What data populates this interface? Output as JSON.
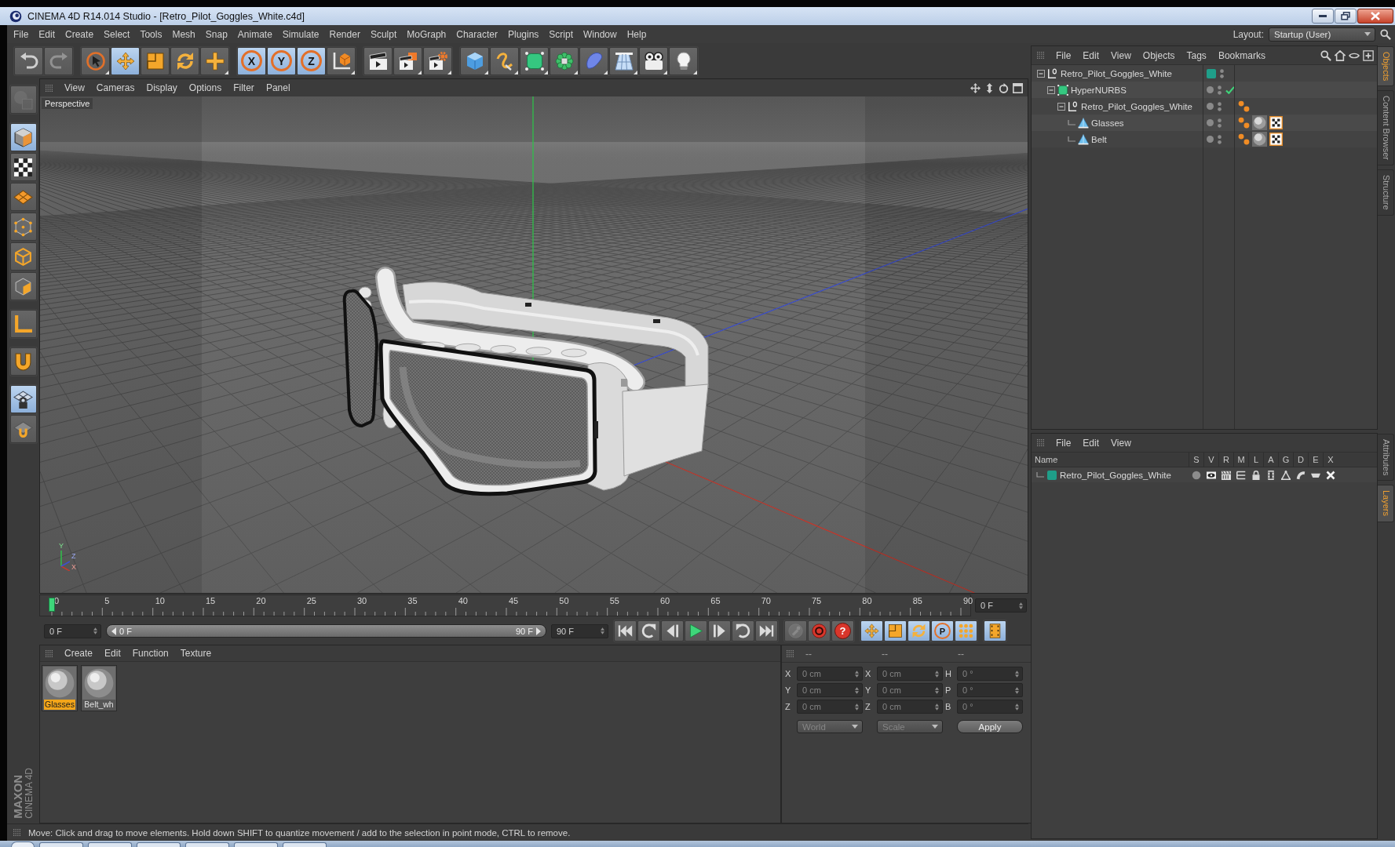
{
  "window": {
    "title": "CINEMA 4D R14.014 Studio - [Retro_Pilot_Goggles_White.c4d]"
  },
  "menu_bar": [
    "File",
    "Edit",
    "Create",
    "Select",
    "Tools",
    "Mesh",
    "Snap",
    "Animate",
    "Simulate",
    "Render",
    "Sculpt",
    "MoGraph",
    "Character",
    "Plugins",
    "Script",
    "Window",
    "Help"
  ],
  "layout": {
    "label": "Layout:",
    "value": "Startup (User)"
  },
  "toolbar": [
    {
      "tools": [
        {
          "kind": "undo",
          "disabled": false
        },
        {
          "kind": "redo",
          "disabled": true
        }
      ]
    },
    {
      "tools": [
        {
          "kind": "live-selection",
          "selected": false
        },
        {
          "kind": "move",
          "selected": true
        },
        {
          "kind": "scale",
          "selected": false
        },
        {
          "kind": "rotate",
          "selected": false
        },
        {
          "kind": "last-tool",
          "selected": false
        }
      ]
    },
    {
      "tools": [
        {
          "kind": "axis-lock",
          "label": "X",
          "selected": true
        },
        {
          "kind": "axis-lock",
          "label": "Y",
          "selected": true
        },
        {
          "kind": "axis-lock",
          "label": "Z",
          "selected": true
        },
        {
          "kind": "coordinate-system",
          "selected": false
        }
      ]
    },
    {
      "tools": [
        {
          "kind": "render-view"
        },
        {
          "kind": "render"
        },
        {
          "kind": "render-settings"
        }
      ]
    },
    {
      "tools": [
        {
          "kind": "cube"
        },
        {
          "kind": "spline"
        },
        {
          "kind": "subdivision"
        },
        {
          "kind": "cloner"
        },
        {
          "kind": "deformer"
        },
        {
          "kind": "floor"
        },
        {
          "kind": "camera"
        },
        {
          "kind": "light"
        }
      ]
    }
  ],
  "left_toolbar": [
    {
      "tools": [
        {
          "kind": "make-editable",
          "disabled": true
        }
      ]
    },
    {
      "tools": [
        {
          "kind": "model",
          "selected": true
        },
        {
          "kind": "texture",
          "selected": false
        },
        {
          "kind": "workplane",
          "selected": false
        },
        {
          "kind": "points",
          "selected": false
        },
        {
          "kind": "edges",
          "selected": false
        },
        {
          "kind": "polygons",
          "selected": false
        }
      ]
    },
    {
      "tools": [
        {
          "kind": "axis-mode",
          "selected": false
        }
      ]
    },
    {
      "tools": [
        {
          "kind": "snap",
          "selected": false
        }
      ]
    },
    {
      "tools": [
        {
          "kind": "workplane-lock",
          "selected": true
        },
        {
          "kind": "tweak",
          "selected": false
        }
      ]
    }
  ],
  "brand": {
    "lines": [
      "MAXON",
      "CINEMA 4D"
    ]
  },
  "viewport": {
    "menu": [
      "View",
      "Cameras",
      "Display",
      "Options",
      "Filter",
      "Panel"
    ],
    "camera": "Perspective",
    "gizmo": [
      {
        "kind": "y",
        "label": "Y"
      },
      {
        "kind": "z",
        "label": "Z"
      },
      {
        "kind": "x",
        "label": "X"
      }
    ]
  },
  "timeline": {
    "ticks": [
      "0",
      "5",
      "10",
      "15",
      "20",
      "25",
      "30",
      "35",
      "40",
      "45",
      "50",
      "55",
      "60",
      "65",
      "70",
      "75",
      "80",
      "85",
      "90"
    ],
    "level": 0,
    "frame": "0 F"
  },
  "transport": {
    "start": "0 F",
    "range_start": "0 F",
    "range_end": "90 F",
    "end": "90 F",
    "groups": [
      {
        "buttons": [
          {
            "kind": "first"
          },
          {
            "kind": "previous-key"
          },
          {
            "kind": "previous-frame"
          },
          {
            "kind": "play"
          },
          {
            "kind": "next-frame"
          },
          {
            "kind": "next-key"
          },
          {
            "kind": "last"
          }
        ]
      },
      {
        "buttons": [
          {
            "kind": "record-keys",
            "disabled": true
          },
          {
            "kind": "autokey",
            "disabled": false
          },
          {
            "kind": "keyframe-selection",
            "label": "?",
            "disabled": false
          }
        ]
      },
      {
        "buttons": [
          {
            "kind": "key-position",
            "selected": true
          },
          {
            "kind": "key-scale",
            "selected": true
          },
          {
            "kind": "key-rotation",
            "selected": true
          },
          {
            "kind": "key-parameter",
            "label": "P",
            "selected": true
          },
          {
            "kind": "key-points",
            "selected": true
          }
        ]
      },
      {
        "buttons": [
          {
            "kind": "timeline",
            "selected": true
          }
        ]
      }
    ]
  },
  "materials": {
    "menu": [
      "Create",
      "Edit",
      "Function",
      "Texture"
    ],
    "items": [
      {
        "name": "Glasses",
        "selected": true
      },
      {
        "name": "Belt_wh",
        "selected": false
      }
    ]
  },
  "coordinates": {
    "disabled": true,
    "headers": [
      "--",
      "--",
      "--"
    ],
    "rows": [
      [
        {
          "label": "X",
          "value": "0 cm"
        },
        {
          "label": "X",
          "value": "0 cm"
        },
        {
          "label": "H",
          "value": "0 °"
        }
      ],
      [
        {
          "label": "Y",
          "value": "0 cm"
        },
        {
          "label": "Y",
          "value": "0 cm"
        },
        {
          "label": "P",
          "value": "0 °"
        }
      ],
      [
        {
          "label": "Z",
          "value": "0 cm"
        },
        {
          "label": "Z",
          "value": "0 cm"
        },
        {
          "label": "B",
          "value": "0 °"
        }
      ]
    ],
    "dropdowns": [
      "World",
      "Scale"
    ],
    "apply": "Apply"
  },
  "status_bar": {
    "text": "Move: Click and drag to move elements. Hold down SHIFT to quantize movement / add to the selection in point mode, CTRL to remove."
  },
  "objects": {
    "menu": [
      "File",
      "Edit",
      "View",
      "Objects",
      "Tags",
      "Bookmarks"
    ],
    "tree": [
      {
        "name": "Retro_Pilot_Goggles_White",
        "kind": "null",
        "color": "#1f9e89",
        "selected": false,
        "expanded": true,
        "children": [
          {
            "name": "HyperNURBS",
            "kind": "hypernurbs",
            "enabled": true,
            "selected": false,
            "expanded": true,
            "children": [
              {
                "name": "Retro_Pilot_Goggles_White",
                "kind": "null",
                "selected": false,
                "expanded": true,
                "tags": [
                  {
                    "kind": "phong"
                  }
                ],
                "children": [
                  {
                    "name": "Glasses",
                    "kind": "polygon",
                    "selected": false,
                    "tags": [
                      {
                        "kind": "phong"
                      },
                      {
                        "kind": "material"
                      },
                      {
                        "kind": "texture"
                      }
                    ]
                  },
                  {
                    "name": "Belt",
                    "kind": "polygon",
                    "selected": false,
                    "tags": [
                      {
                        "kind": "phong"
                      },
                      {
                        "kind": "material"
                      },
                      {
                        "kind": "texture"
                      }
                    ]
                  }
                ]
              }
            ]
          }
        ]
      }
    ]
  },
  "layers": {
    "menu": [
      "File",
      "Edit",
      "View"
    ],
    "columns": [
      "Name",
      "S",
      "V",
      "R",
      "M",
      "L",
      "A",
      "G",
      "D",
      "E",
      "X"
    ],
    "rows": [
      {
        "name": "Retro_Pilot_Goggles_White",
        "color": "#1f9e89",
        "selected": false,
        "toggles": [
          {
            "kind": "solo"
          },
          {
            "kind": "view"
          },
          {
            "kind": "render"
          },
          {
            "kind": "manager"
          },
          {
            "kind": "locked"
          },
          {
            "kind": "animation"
          },
          {
            "kind": "generators"
          },
          {
            "kind": "deformers"
          },
          {
            "kind": "expressions"
          },
          {
            "kind": "xref"
          }
        ]
      }
    ]
  },
  "side_tabs": [
    {
      "tabs": [
        {
          "label": "Objects",
          "selected": true
        },
        {
          "label": "Content Browser",
          "selected": false
        },
        {
          "label": "Structure",
          "selected": false
        }
      ]
    },
    {
      "tabs": [
        {
          "label": "Attributes",
          "selected": false
        },
        {
          "label": "Layers",
          "selected": true
        }
      ]
    }
  ]
}
